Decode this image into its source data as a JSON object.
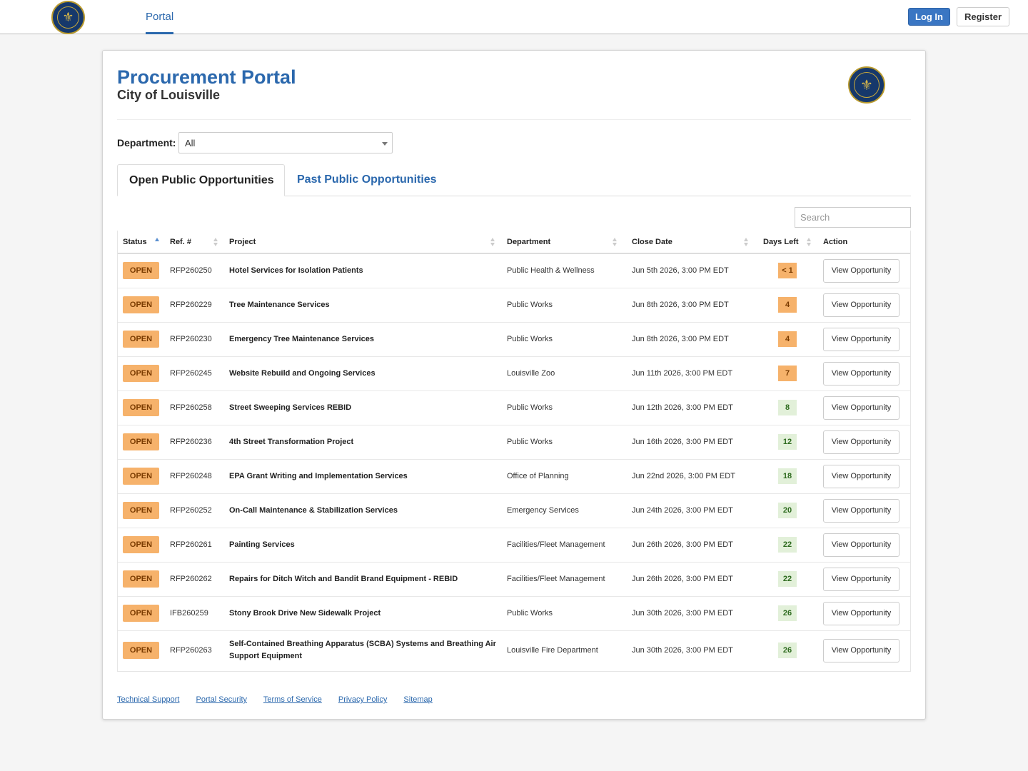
{
  "nav": {
    "portal_label": "Portal",
    "login_label": "Log In",
    "register_label": "Register",
    "seal_glyph": "⚜",
    "seal_icon": "city-seal-logo"
  },
  "header": {
    "title": "Procurement Portal",
    "subtitle": "City of Louisville"
  },
  "filter": {
    "department_label": "Department:",
    "department_value": "All"
  },
  "tabs": [
    {
      "label": "Open Public Opportunities",
      "active": true
    },
    {
      "label": "Past Public Opportunities",
      "active": false
    }
  ],
  "search": {
    "placeholder": "Search"
  },
  "table": {
    "columns": [
      "Status",
      "Ref. #",
      "Project",
      "Department",
      "Close Date",
      "Days Left",
      "Action"
    ],
    "rows": [
      {
        "status": "OPEN",
        "ref": "RFP260250",
        "project": "Hotel Services for Isolation Patients",
        "department": "Public Health & Wellness",
        "close_date": "Jun 5th 2026, 3:00 PM EDT",
        "days_left": "< 1",
        "urgent": true,
        "action": "View Opportunity"
      },
      {
        "status": "OPEN",
        "ref": "RFP260229",
        "project": "Tree Maintenance Services",
        "department": "Public Works",
        "close_date": "Jun 8th 2026, 3:00 PM EDT",
        "days_left": "4",
        "urgent": true,
        "action": "View Opportunity"
      },
      {
        "status": "OPEN",
        "ref": "RFP260230",
        "project": "Emergency Tree Maintenance Services",
        "department": "Public Works",
        "close_date": "Jun 8th 2026, 3:00 PM EDT",
        "days_left": "4",
        "urgent": true,
        "action": "View Opportunity"
      },
      {
        "status": "OPEN",
        "ref": "RFP260245",
        "project": "Website Rebuild and Ongoing Services",
        "department": "Louisville Zoo",
        "close_date": "Jun 11th 2026, 3:00 PM EDT",
        "days_left": "7",
        "urgent": true,
        "action": "View Opportunity"
      },
      {
        "status": "OPEN",
        "ref": "RFP260258",
        "project": "Street Sweeping Services REBID",
        "department": "Public Works",
        "close_date": "Jun 12th 2026, 3:00 PM EDT",
        "days_left": "8",
        "urgent": false,
        "action": "View Opportunity"
      },
      {
        "status": "OPEN",
        "ref": "RFP260236",
        "project": "4th Street Transformation Project",
        "department": "Public Works",
        "close_date": "Jun 16th 2026, 3:00 PM EDT",
        "days_left": "12",
        "urgent": false,
        "action": "View Opportunity"
      },
      {
        "status": "OPEN",
        "ref": "RFP260248",
        "project": "EPA Grant Writing and Implementation Services",
        "department": "Office of Planning",
        "close_date": "Jun 22nd 2026, 3:00 PM EDT",
        "days_left": "18",
        "urgent": false,
        "action": "View Opportunity"
      },
      {
        "status": "OPEN",
        "ref": "RFP260252",
        "project": "On-Call Maintenance & Stabilization Services",
        "department": "Emergency Services",
        "close_date": "Jun 24th 2026, 3:00 PM EDT",
        "days_left": "20",
        "urgent": false,
        "action": "View Opportunity"
      },
      {
        "status": "OPEN",
        "ref": "RFP260261",
        "project": "Painting Services",
        "department": "Facilities/Fleet Management",
        "close_date": "Jun 26th 2026, 3:00 PM EDT",
        "days_left": "22",
        "urgent": false,
        "action": "View Opportunity"
      },
      {
        "status": "OPEN",
        "ref": "RFP260262",
        "project": "Repairs for Ditch Witch and Bandit Brand Equipment - REBID",
        "department": "Facilities/Fleet Management",
        "close_date": "Jun 26th 2026, 3:00 PM EDT",
        "days_left": "22",
        "urgent": false,
        "action": "View Opportunity"
      },
      {
        "status": "OPEN",
        "ref": "IFB260259",
        "project": "Stony Brook Drive New Sidewalk Project",
        "department": "Public Works",
        "close_date": "Jun 30th 2026, 3:00 PM EDT",
        "days_left": "26",
        "urgent": false,
        "action": "View Opportunity"
      },
      {
        "status": "OPEN",
        "ref": "RFP260263",
        "project": "Self-Contained Breathing Apparatus (SCBA) Systems and Breathing Air Support Equipment",
        "department": "Louisville Fire Department",
        "close_date": "Jun 30th 2026, 3:00 PM EDT",
        "days_left": "26",
        "urgent": false,
        "action": "View Opportunity"
      }
    ]
  },
  "footer": {
    "links": [
      "Technical Support",
      "Portal Security",
      "Terms of Service",
      "Privacy Policy",
      "Sitemap"
    ]
  },
  "colors": {
    "brand": "#2b68ad",
    "open_badge": "#f6b26b",
    "days_ok": "#e2f0d9",
    "login": "#3a76c3"
  }
}
